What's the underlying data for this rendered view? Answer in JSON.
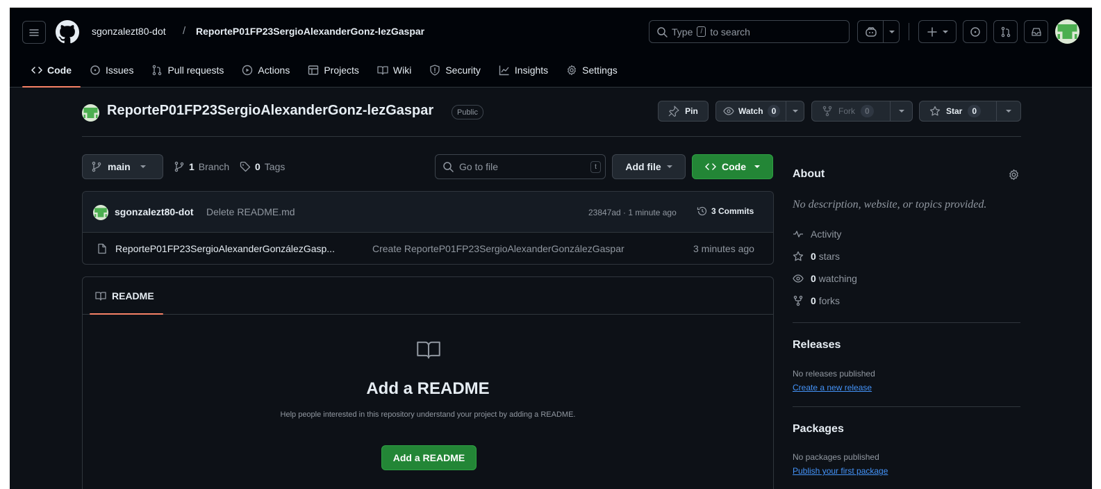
{
  "header": {
    "owner": "sgonzalezt80-dot",
    "separator": "/",
    "repo": "ReporteP01FP23SergioAlexanderGonz-lezGaspar",
    "search_prefix": "Type",
    "search_key": "/",
    "search_suffix": "to search"
  },
  "nav": {
    "tabs": [
      {
        "label": "Code",
        "icon": "code-icon"
      },
      {
        "label": "Issues",
        "icon": "issue-icon"
      },
      {
        "label": "Pull requests",
        "icon": "pull-request-icon"
      },
      {
        "label": "Actions",
        "icon": "play-icon"
      },
      {
        "label": "Projects",
        "icon": "table-icon"
      },
      {
        "label": "Wiki",
        "icon": "book-icon"
      },
      {
        "label": "Security",
        "icon": "shield-icon"
      },
      {
        "label": "Insights",
        "icon": "graph-icon"
      },
      {
        "label": "Settings",
        "icon": "gear-icon"
      }
    ]
  },
  "repo": {
    "title": "ReporteP01FP23SergioAlexanderGonz-lezGaspar",
    "visibility": "Public",
    "pin_label": "Pin",
    "watch_label": "Watch",
    "watch_count": "0",
    "fork_label": "Fork",
    "fork_count": "0",
    "star_label": "Star",
    "star_count": "0"
  },
  "toolbar": {
    "branch": "main",
    "branch_count": "1",
    "branch_label": "Branch",
    "tag_count": "0",
    "tag_label": "Tags",
    "goto_placeholder": "Go to file",
    "goto_key": "t",
    "add_file": "Add file",
    "code": "Code"
  },
  "commit": {
    "author": "sgonzalezt80-dot",
    "message": "Delete README.md",
    "hash_time": "23847ad · 1 minute ago",
    "commits": "3 Commits"
  },
  "files": [
    {
      "name": "ReporteP01FP23SergioAlexanderGonzálezGasp...",
      "message": "Create ReporteP01FP23SergioAlexanderGonzálezGaspar",
      "time": "3 minutes ago"
    }
  ],
  "readme": {
    "tab": "README",
    "title": "Add a README",
    "description": "Help people interested in this repository understand your project by adding a README.",
    "button": "Add a README"
  },
  "about": {
    "title": "About",
    "description": "No description, website, or topics provided.",
    "activity": "Activity",
    "stars_count": "0",
    "stars_label": "stars",
    "watching_count": "0",
    "watching_label": "watching",
    "forks_count": "0",
    "forks_label": "forks"
  },
  "releases": {
    "title": "Releases",
    "text": "No releases published",
    "link": "Create a new release"
  },
  "packages": {
    "title": "Packages",
    "text": "No packages published",
    "link": "Publish your first package"
  },
  "colors": {
    "background": "#0d1117",
    "header": "#010409",
    "accent": "#f78166",
    "green": "#238636",
    "link": "#4493f8"
  }
}
